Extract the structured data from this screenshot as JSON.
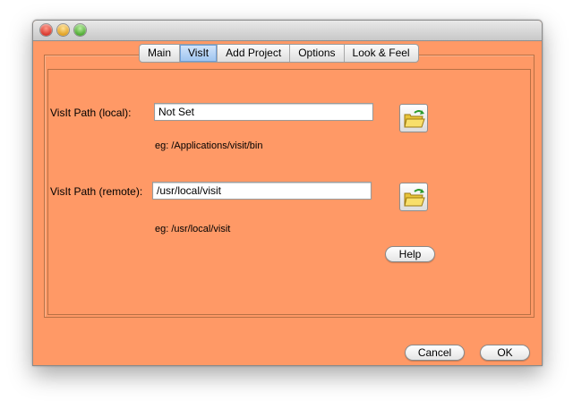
{
  "tabs": [
    {
      "label": "Main",
      "active": false
    },
    {
      "label": "VisIt",
      "active": true
    },
    {
      "label": "Add Project",
      "active": false
    },
    {
      "label": "Options",
      "active": false
    },
    {
      "label": "Look & Feel",
      "active": false
    }
  ],
  "local": {
    "label": "VisIt Path (local):",
    "value": "Not Set",
    "example": "eg: /Applications/visit/bin",
    "browse_icon": "open-folder-icon"
  },
  "remote": {
    "label": "VisIt Path (remote):",
    "value": "/usr/local/visit",
    "example": "eg: /usr/local/visit",
    "browse_icon": "open-folder-icon"
  },
  "buttons": {
    "help": "Help",
    "cancel": "Cancel",
    "ok": "OK"
  },
  "colors": {
    "window_background": "#ff9966",
    "active_tab": "#9cc3ef"
  }
}
